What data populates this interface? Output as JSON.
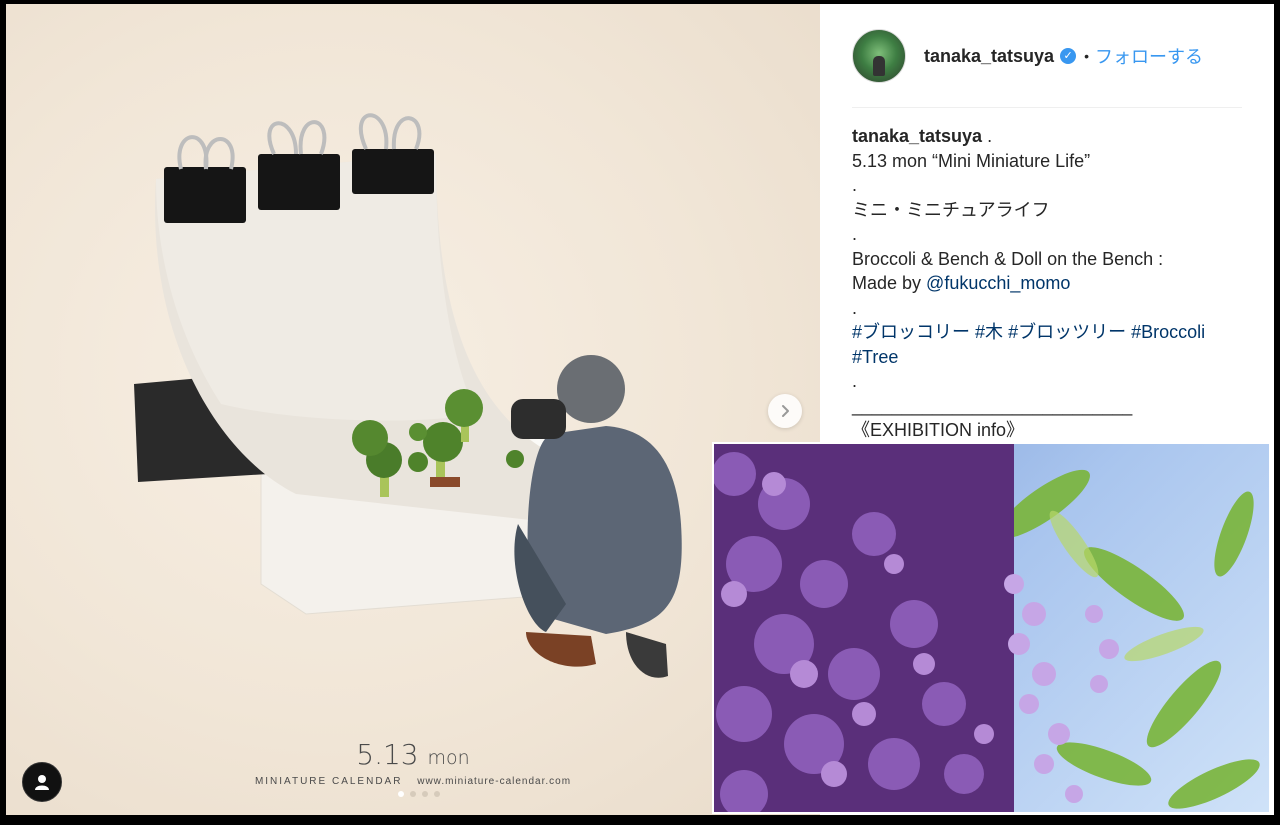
{
  "post": {
    "username": "tanaka_tatsuya",
    "follow_label": "フォローする",
    "separator": "•"
  },
  "caption": {
    "username": "tanaka_tatsuya",
    "username_suffix": " .",
    "lines": [
      "5.13 mon “Mini Miniature Life”",
      ".",
      "ミニ・ミニチュアライフ",
      ".",
      "Broccoli & Bench & Doll on the Bench :"
    ],
    "made_by_prefix": "Made by ",
    "mention": "@fukucchi_momo",
    "dot3": ".",
    "hashtags_line1": [
      "#ブロッコリー",
      "#木",
      "#ブロッツリー",
      "#Broccoli"
    ],
    "hashtags_line2": [
      "#Tree"
    ],
    "dot4": ".",
    "rule": "____________________________",
    "exhibition": "《EXHIBITION info》"
  },
  "image": {
    "date_big": "5.13",
    "date_day": "mon",
    "brand": "MINIATURE CALENDAR",
    "url": "www.miniature-calendar.com"
  },
  "carousel": {
    "dots": 4,
    "active_index": 0
  },
  "icons": [
    "verified-icon",
    "chevron-right-icon",
    "profile-icon"
  ],
  "colors": {
    "link_blue": "#3897f0",
    "mention_blue": "#003569",
    "text": "#262626"
  }
}
